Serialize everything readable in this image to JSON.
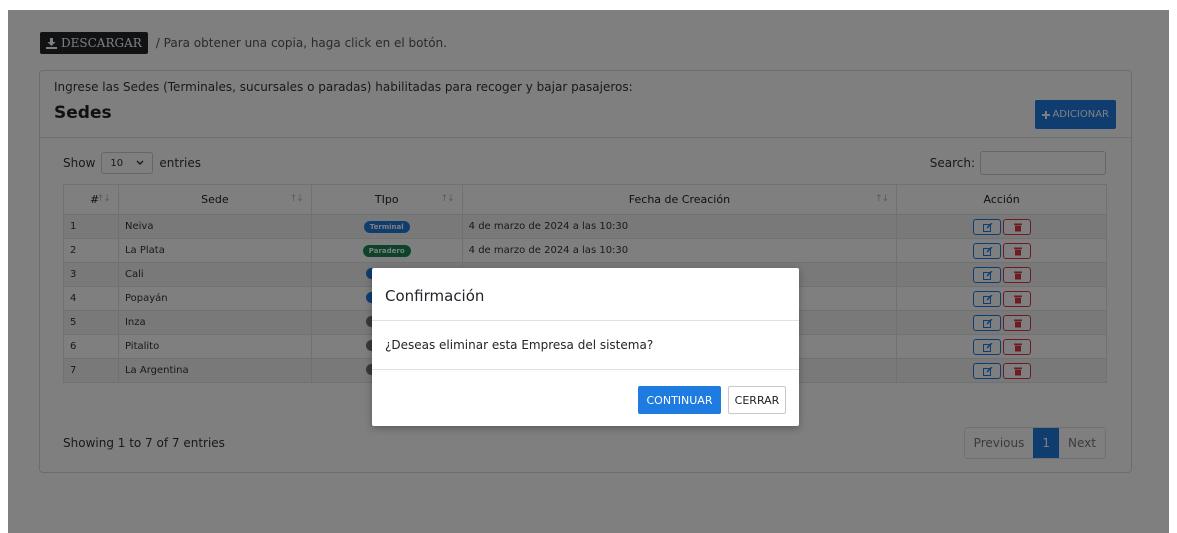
{
  "download": {
    "button_label": "DESCARGAR",
    "note": "/ Para obtener una copia, haga click en el botón."
  },
  "card": {
    "subtitle": "Ingrese las Sedes (Terminales, sucursales o paradas) habilitadas para recoger y bajar pasajeros:",
    "title": "Sedes",
    "add_label": "ADICIONAR"
  },
  "controls": {
    "show_label": "Show",
    "entries_value": "10",
    "entries_label": "entries",
    "search_label": "Search:"
  },
  "table": {
    "headers": [
      "#",
      "Sede",
      "TIpo",
      "Fecha de Creación",
      "Acción"
    ],
    "rows": [
      {
        "num": "1",
        "sede": "Neiva",
        "tipo": "Terminal",
        "tipo_color": "#1e7be0",
        "fecha": "4 de marzo de 2024 a las 10:30"
      },
      {
        "num": "2",
        "sede": "La Plata",
        "tipo": "Paradero",
        "tipo_color": "#198754",
        "fecha": "4 de marzo de 2024 a las 10:30"
      },
      {
        "num": "3",
        "sede": "Cali",
        "tipo": "",
        "tipo_color": "#1e7be0",
        "fecha": ""
      },
      {
        "num": "4",
        "sede": "Popayán",
        "tipo": "",
        "tipo_color": "#1e7be0",
        "fecha": ""
      },
      {
        "num": "5",
        "sede": "Inza",
        "tipo": "",
        "tipo_color": "#6c757d",
        "fecha": ""
      },
      {
        "num": "6",
        "sede": "Pitalito",
        "tipo": "",
        "tipo_color": "#6c757d",
        "fecha": ""
      },
      {
        "num": "7",
        "sede": "La Argentina",
        "tipo": "",
        "tipo_color": "#6c757d",
        "fecha": ""
      }
    ]
  },
  "footer": {
    "info": "Showing 1 to 7 of 7 entries",
    "previous": "Previous",
    "current_page": "1",
    "next": "Next"
  },
  "modal": {
    "title": "Confirmación",
    "body": "¿Deseas eliminar esta Empresa del sistema?",
    "continue_label": "CONTINUAR",
    "close_label": "CERRAR"
  },
  "icons": {
    "download": "download-icon",
    "add": "plus-icon",
    "edit": "edit-icon",
    "delete": "trash-icon",
    "select": "chevron-down-icon"
  }
}
